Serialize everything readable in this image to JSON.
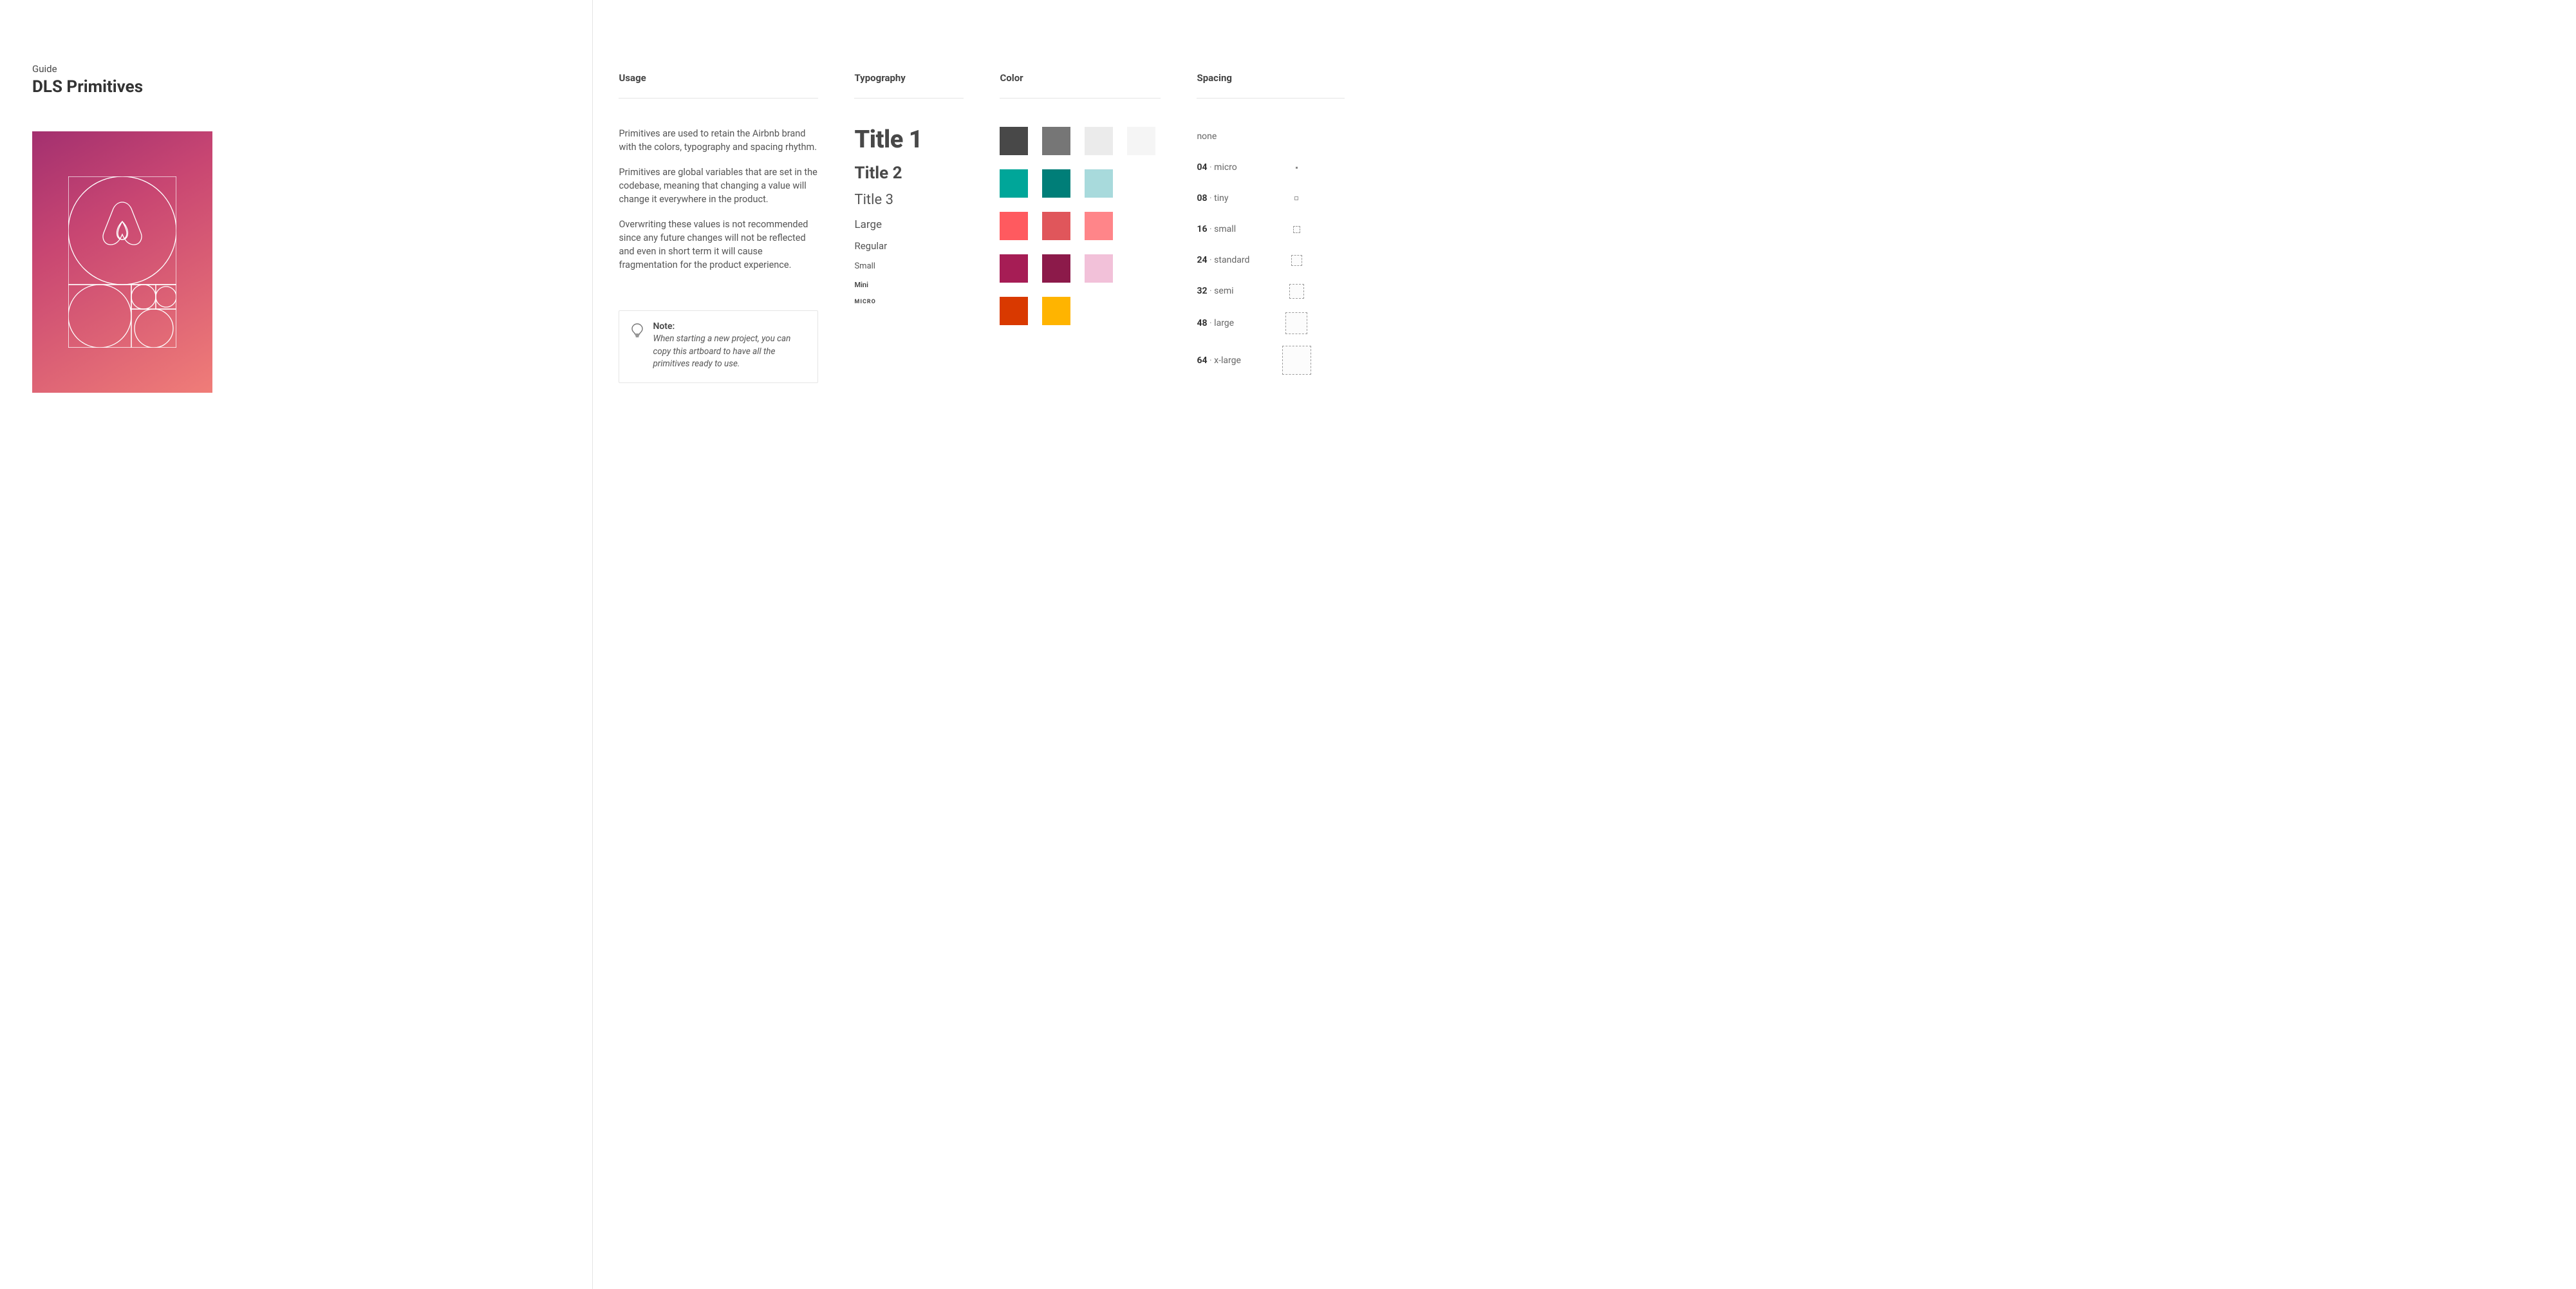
{
  "guide": {
    "eyebrow": "Guide",
    "title": "DLS Primitives"
  },
  "sections": {
    "usage": {
      "title": "Usage",
      "paragraphs": [
        "Primitives are used to retain the Airbnb brand with  the colors, typography and spacing rhythm.",
        "Primitives are global variables that are set in the codebase, meaning that changing a value will change it everywhere in the product.",
        "Overwriting these values is not recommended since any future changes will not be reflected and even in short term it will cause fragmentation for the product experience."
      ],
      "note": {
        "label": "Note:",
        "body": "When starting a new project, you can copy this artboard to have all the primitives ready to use."
      }
    },
    "typography": {
      "title": "Typography",
      "items": [
        {
          "role": "title1",
          "label": "Title 1"
        },
        {
          "role": "title2",
          "label": "Title 2"
        },
        {
          "role": "title3",
          "label": "Title 3"
        },
        {
          "role": "large",
          "label": "Large"
        },
        {
          "role": "regular",
          "label": "Regular"
        },
        {
          "role": "small",
          "label": "Small"
        },
        {
          "role": "mini",
          "label": "Mini"
        },
        {
          "role": "micro",
          "label": "MICRO"
        }
      ]
    },
    "color": {
      "title": "Color",
      "rows": [
        [
          "#484848",
          "#767676",
          "#ebebeb",
          "#f5f5f5"
        ],
        [
          "#00A699",
          "#007E78",
          "#A8DADC"
        ],
        [
          "#FF5A5F",
          "#E0565B",
          "#FF8589"
        ],
        [
          "#A61D55",
          "#8C1A4A",
          "#F2C1D9"
        ],
        [
          "#D93900",
          "#FFB400"
        ]
      ]
    },
    "spacing": {
      "title": "Spacing",
      "items": [
        {
          "value": "",
          "name": "none",
          "size": 0
        },
        {
          "value": "04",
          "name": "micro",
          "size": 4
        },
        {
          "value": "08",
          "name": "tiny",
          "size": 8
        },
        {
          "value": "16",
          "name": "small",
          "size": 16
        },
        {
          "value": "24",
          "name": "standard",
          "size": 24
        },
        {
          "value": "32",
          "name": "semi",
          "size": 32
        },
        {
          "value": "48",
          "name": "large",
          "size": 48
        },
        {
          "value": "64",
          "name": "x-large",
          "size": 64
        }
      ]
    }
  }
}
